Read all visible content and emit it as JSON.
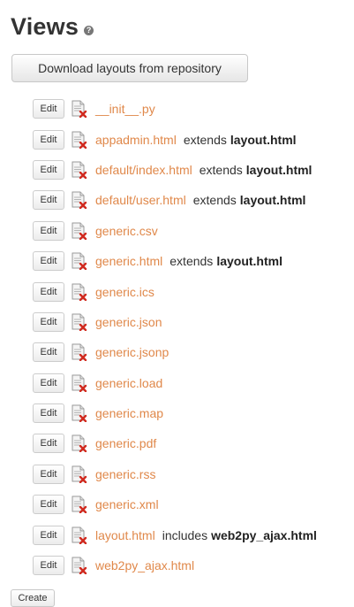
{
  "header": {
    "title": "Views",
    "help_icon": "question-circle-icon",
    "help_glyph": "?"
  },
  "download_button": {
    "label": "Download layouts from repository"
  },
  "colors": {
    "link": "#e0884a",
    "text": "#333333"
  },
  "files": [
    {
      "edit_label": "Edit",
      "name": "__init__.py",
      "relation": "",
      "parent": ""
    },
    {
      "edit_label": "Edit",
      "name": "appadmin.html",
      "relation": "extends",
      "parent": "layout.html"
    },
    {
      "edit_label": "Edit",
      "name": "default/index.html",
      "relation": "extends",
      "parent": "layout.html"
    },
    {
      "edit_label": "Edit",
      "name": "default/user.html",
      "relation": "extends",
      "parent": "layout.html"
    },
    {
      "edit_label": "Edit",
      "name": "generic.csv",
      "relation": "",
      "parent": ""
    },
    {
      "edit_label": "Edit",
      "name": "generic.html",
      "relation": "extends",
      "parent": "layout.html"
    },
    {
      "edit_label": "Edit",
      "name": "generic.ics",
      "relation": "",
      "parent": ""
    },
    {
      "edit_label": "Edit",
      "name": "generic.json",
      "relation": "",
      "parent": ""
    },
    {
      "edit_label": "Edit",
      "name": "generic.jsonp",
      "relation": "",
      "parent": ""
    },
    {
      "edit_label": "Edit",
      "name": "generic.load",
      "relation": "",
      "parent": ""
    },
    {
      "edit_label": "Edit",
      "name": "generic.map",
      "relation": "",
      "parent": ""
    },
    {
      "edit_label": "Edit",
      "name": "generic.pdf",
      "relation": "",
      "parent": ""
    },
    {
      "edit_label": "Edit",
      "name": "generic.rss",
      "relation": "",
      "parent": ""
    },
    {
      "edit_label": "Edit",
      "name": "generic.xml",
      "relation": "",
      "parent": ""
    },
    {
      "edit_label": "Edit",
      "name": "layout.html",
      "relation": "includes",
      "parent": "web2py_ajax.html"
    },
    {
      "edit_label": "Edit",
      "name": "web2py_ajax.html",
      "relation": "",
      "parent": ""
    }
  ],
  "create_button": {
    "label": "Create"
  }
}
